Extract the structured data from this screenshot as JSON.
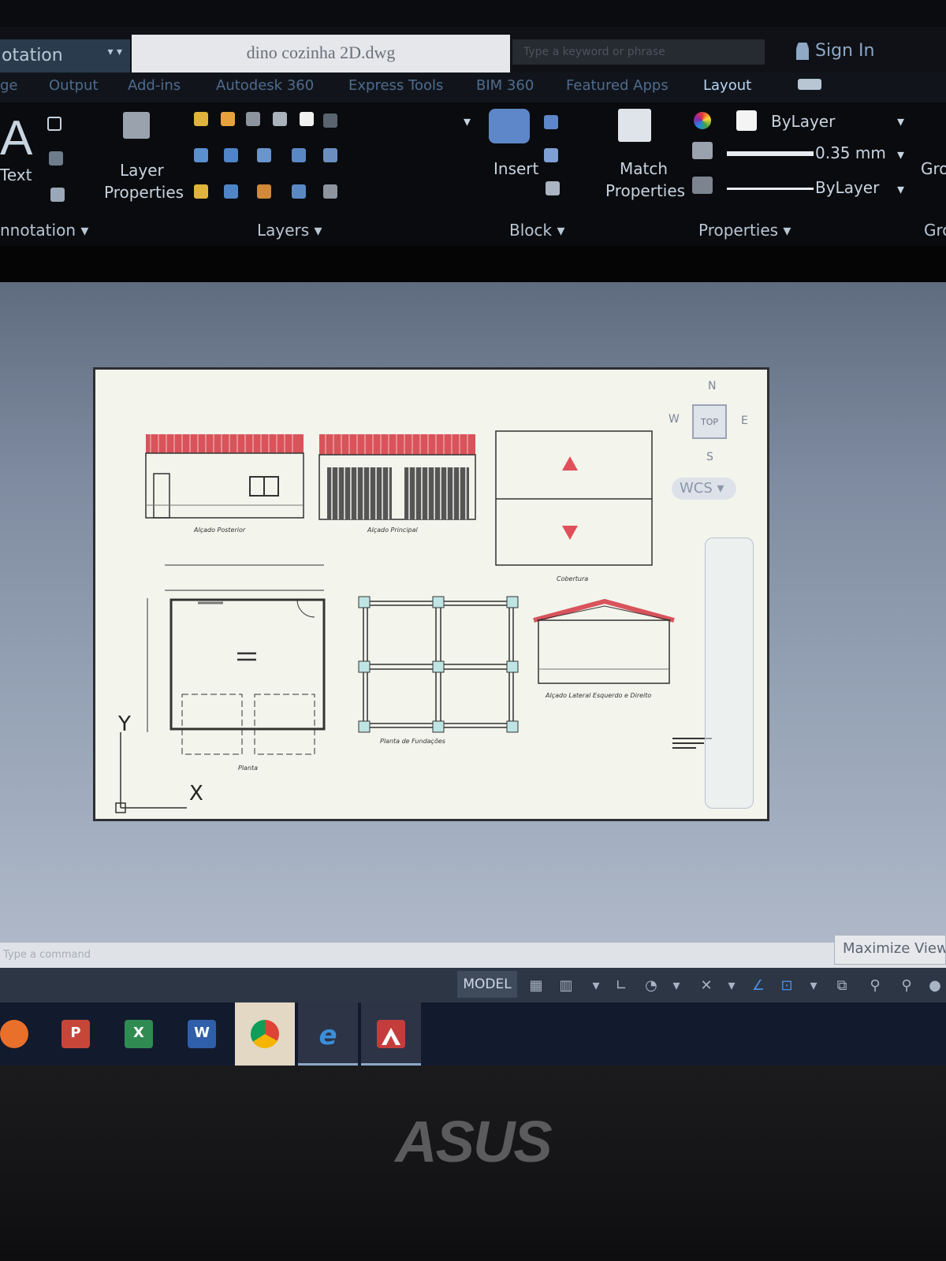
{
  "window": {
    "workspace_label": "otation",
    "document_title": "dino cozinha 2D.dwg",
    "search_placeholder": "Type a keyword or phrase",
    "signin_label": "Sign In"
  },
  "ribbon_tabs": [
    {
      "label": "ge"
    },
    {
      "label": "Output"
    },
    {
      "label": "Add-ins"
    },
    {
      "label": "Autodesk 360"
    },
    {
      "label": "Express Tools"
    },
    {
      "label": "BIM 360"
    },
    {
      "label": "Featured Apps"
    },
    {
      "label": "Layout",
      "active": true
    }
  ],
  "ribbon": {
    "text_tool": "Text",
    "layer_properties_line1": "Layer",
    "layer_properties_line2": "Properties",
    "insert_label": "Insert",
    "match_properties_line1": "Match",
    "match_properties_line2": "Properties",
    "color_value": "ByLayer",
    "lineweight_value": "0.35 mm",
    "linetype_value": "ByLayer",
    "group_partial": "Gro",
    "panels": {
      "annotation": "nnotation",
      "layers": "Layers",
      "block": "Block",
      "properties": "Properties",
      "groups": "Gro"
    }
  },
  "drawing": {
    "views": [
      {
        "caption": "Alçado Posterior"
      },
      {
        "caption": "Alçado Principal"
      },
      {
        "caption": "Cobertura"
      },
      {
        "caption": "Planta de Fundações"
      },
      {
        "caption": "Alçado Lateral Esquerdo e Direito"
      },
      {
        "caption": "Planta"
      }
    ],
    "ucs": {
      "y": "Y",
      "x": "X"
    },
    "accent_red": "#e0505a",
    "roof_red": "#d9535b"
  },
  "viewcube": {
    "north": "N",
    "south": "S",
    "east": "E",
    "west": "W",
    "top": "TOP",
    "wcs": "WCS"
  },
  "command_line": {
    "placeholder": "Type a command"
  },
  "status_bar": {
    "model_label": "MODEL",
    "tooltip": "Maximize Viewport"
  },
  "taskbar": {
    "apps": [
      {
        "name": "Firefox",
        "icon": "firefox-icon",
        "color": "#e8702a"
      },
      {
        "name": "PowerPoint",
        "icon": "powerpoint-icon",
        "color": "#c6463a",
        "glyph": "P"
      },
      {
        "name": "Excel",
        "icon": "excel-icon",
        "color": "#2f8b52",
        "glyph": "X"
      },
      {
        "name": "Word",
        "icon": "word-icon",
        "color": "#2e5fa8",
        "glyph": "W"
      },
      {
        "name": "Chrome",
        "icon": "chrome-icon",
        "color": "#4caf50"
      },
      {
        "name": "Internet Explorer",
        "icon": "ie-icon",
        "color": "#3b8fd9",
        "glyph": "e"
      },
      {
        "name": "AutoCAD",
        "icon": "autocad-icon",
        "color": "#c43d3d"
      }
    ]
  },
  "hardware": {
    "brand": "ASUS"
  }
}
